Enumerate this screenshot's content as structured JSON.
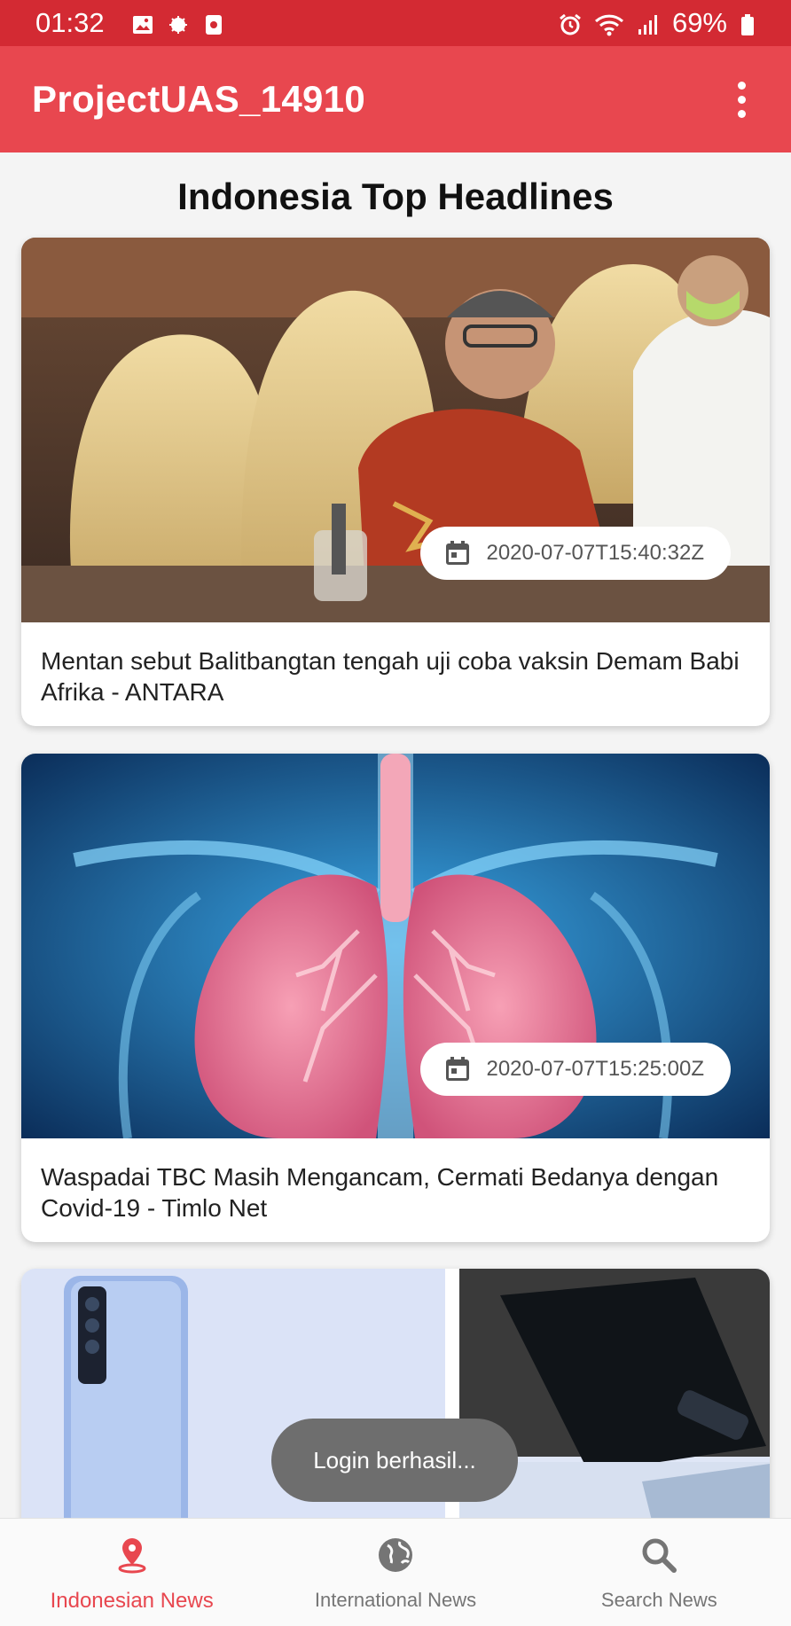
{
  "status_bar": {
    "time": "01:32",
    "battery": "69%"
  },
  "app_bar": {
    "title": "ProjectUAS_14910"
  },
  "page": {
    "heading": "Indonesia Top Headlines"
  },
  "articles": [
    {
      "date": "2020-07-07T15:40:32Z",
      "title": "Mentan sebut Balitbangtan tengah uji coba vaksin Demam Babi Afrika - ANTARA"
    },
    {
      "date": "2020-07-07T15:25:00Z",
      "title": "Waspadai TBC Masih Mengancam, Cermati Bedanya dengan Covid-19 - Timlo Net"
    },
    {
      "date": "",
      "title": ""
    }
  ],
  "toast": {
    "message": "Login berhasil..."
  },
  "bottom_nav": {
    "items": [
      {
        "label": "Indonesian News",
        "icon": "location-pin-icon",
        "active": true
      },
      {
        "label": "International News",
        "icon": "globe-icon",
        "active": false
      },
      {
        "label": "Search News",
        "icon": "search-icon",
        "active": false
      }
    ]
  },
  "colors": {
    "status_bar": "#d32a33",
    "app_bar": "#e8474f",
    "active_nav": "#e8474f"
  }
}
